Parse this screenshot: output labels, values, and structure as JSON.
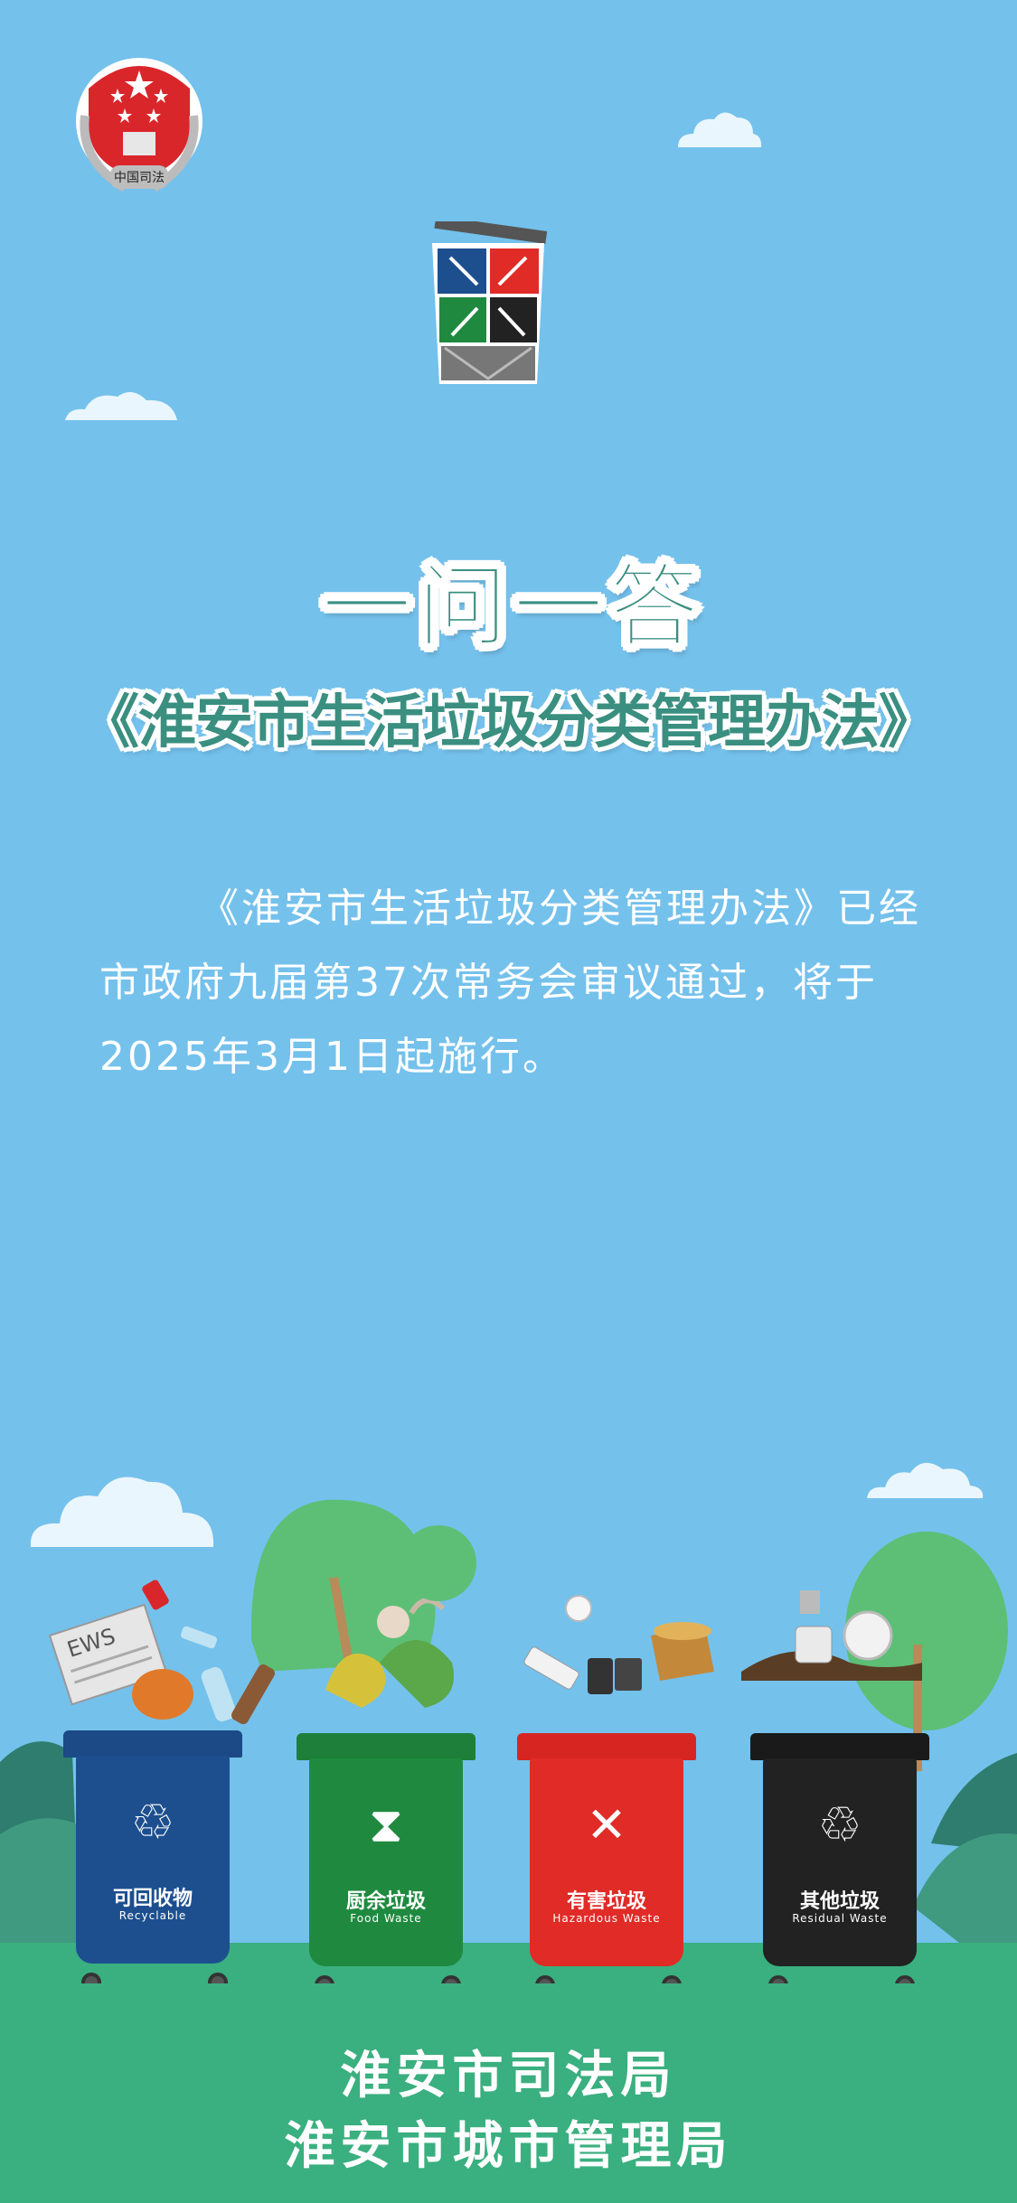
{
  "emblem": {
    "text": "中国司法"
  },
  "title": {
    "line1": "一问一答",
    "line2": "《淮安市生活垃圾分类管理办法》"
  },
  "intro": {
    "text": "《淮安市生活垃圾分类管理办法》已经市政府九届第37次常务会审议通过，将于2025年3月1日起施行。"
  },
  "bins": [
    {
      "name_cn": "可回收物",
      "name_en": "Recyclable",
      "color": "#1d4f8f",
      "icon": "recycle-icon"
    },
    {
      "name_cn": "厨余垃圾",
      "name_en": "Food  Waste",
      "color": "#1f8a3f",
      "icon": "hourglass-icon"
    },
    {
      "name_cn": "有害垃圾",
      "name_en": "Hazardous  Waste",
      "color": "#e02b26",
      "icon": "hazard-x-icon"
    },
    {
      "name_cn": "其他垃圾",
      "name_en": "Residual Waste",
      "color": "#222222",
      "icon": "recycle-icon"
    }
  ],
  "footer": {
    "line1": "淮安市司法局",
    "line2": "淮安市城市管理局"
  },
  "colors": {
    "sky": "#74c1ec",
    "ground": "#3aaf7f",
    "title": "#3a8f80",
    "tree": "#5dbf75"
  }
}
